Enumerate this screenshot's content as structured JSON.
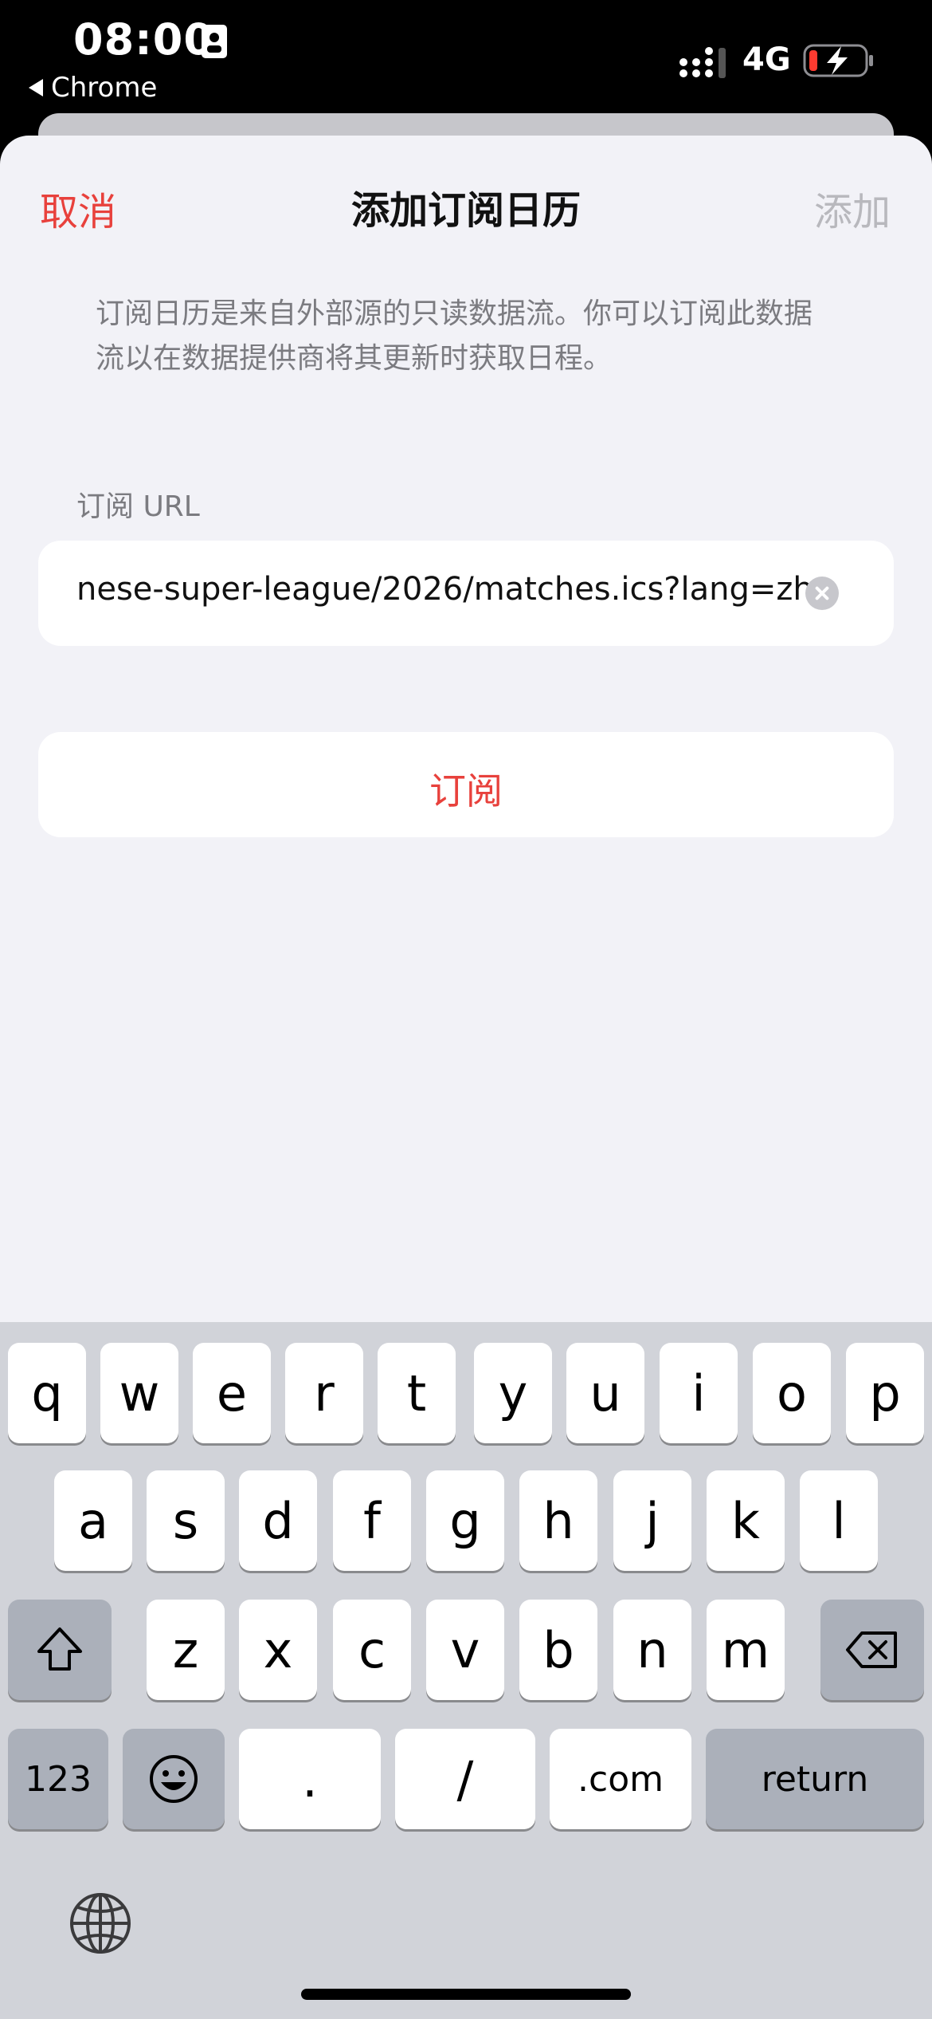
{
  "status_bar": {
    "time": "08:00",
    "back_app": "Chrome",
    "network": "4G",
    "icons": [
      "contact-card-icon",
      "signal-icon",
      "battery-charging-icon"
    ]
  },
  "nav": {
    "cancel": "取消",
    "title": "添加订阅日历",
    "add": "添加"
  },
  "description": "订阅日历是来自外部源的只读数据流。你可以订阅此数据流以在数据提供商将其更新时获取日程。",
  "url_section": {
    "label": "订阅 URL",
    "value": "nese-super-league/2026/matches.ics?lang=zh"
  },
  "subscribe_button": "订阅",
  "keyboard": {
    "row1": [
      "q",
      "w",
      "e",
      "r",
      "t",
      "y",
      "u",
      "i",
      "o",
      "p"
    ],
    "row2": [
      "a",
      "s",
      "d",
      "f",
      "g",
      "h",
      "j",
      "k",
      "l"
    ],
    "row3": [
      "z",
      "x",
      "c",
      "v",
      "b",
      "n",
      "m"
    ],
    "row4": {
      "numbers": "123",
      "dot": ".",
      "slash": "/",
      "dotcom": ".com",
      "return": "return"
    }
  },
  "colors": {
    "accent": "#e8413c",
    "disabled": "#b8b8bd",
    "background": "#f2f2f7",
    "keyboard": "#d1d3d9"
  }
}
